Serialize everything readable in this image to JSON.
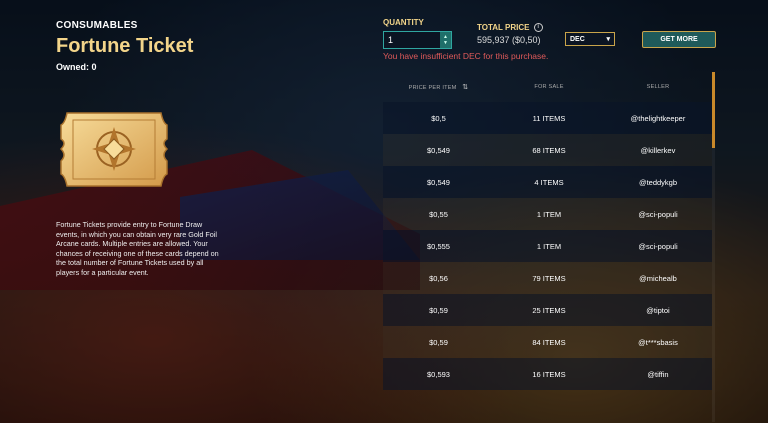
{
  "header": {
    "category": "CONSUMABLES",
    "title": "Fortune Ticket",
    "owned": "Owned: 0"
  },
  "description": "Fortune Tickets provide entry to Fortune Draw events, in which you can obtain very rare Gold Foil Arcane cards. Multiple entries are allowed. Your chances of receiving one of these cards depend on the total number of Fortune Tickets used by all players for a particular event.",
  "purchase": {
    "quantity_label": "QUANTITY",
    "quantity_value": "1",
    "total_price_label": "TOTAL PRICE",
    "total_price_value": "595,937 ($0,50)",
    "currency": "DEC",
    "get_more_label": "GET MORE",
    "warning": "You have insufficient DEC for this purchase."
  },
  "table": {
    "columns": [
      "PRICE PER ITEM",
      "FOR SALE",
      "SELLER"
    ],
    "rows": [
      {
        "price": "$0,5",
        "for_sale": "11 ITEMS",
        "seller": "@thelightkeeper"
      },
      {
        "price": "$0,549",
        "for_sale": "68 ITEMS",
        "seller": "@killerkev"
      },
      {
        "price": "$0,549",
        "for_sale": "4 ITEMS",
        "seller": "@teddykgb"
      },
      {
        "price": "$0,55",
        "for_sale": "1 ITEM",
        "seller": "@sci-populi"
      },
      {
        "price": "$0,555",
        "for_sale": "1 ITEM",
        "seller": "@sci-populi"
      },
      {
        "price": "$0,56",
        "for_sale": "79 ITEMS",
        "seller": "@michealb"
      },
      {
        "price": "$0,59",
        "for_sale": "25 ITEMS",
        "seller": "@tiptoi"
      },
      {
        "price": "$0,59",
        "for_sale": "84 ITEMS",
        "seller": "@t***sbasis"
      },
      {
        "price": "$0,593",
        "for_sale": "16 ITEMS",
        "seller": "@tiffin"
      }
    ]
  },
  "colors": {
    "gold": "#f3d58a",
    "teal": "#2fa6a0",
    "warning": "#e05a5a"
  }
}
